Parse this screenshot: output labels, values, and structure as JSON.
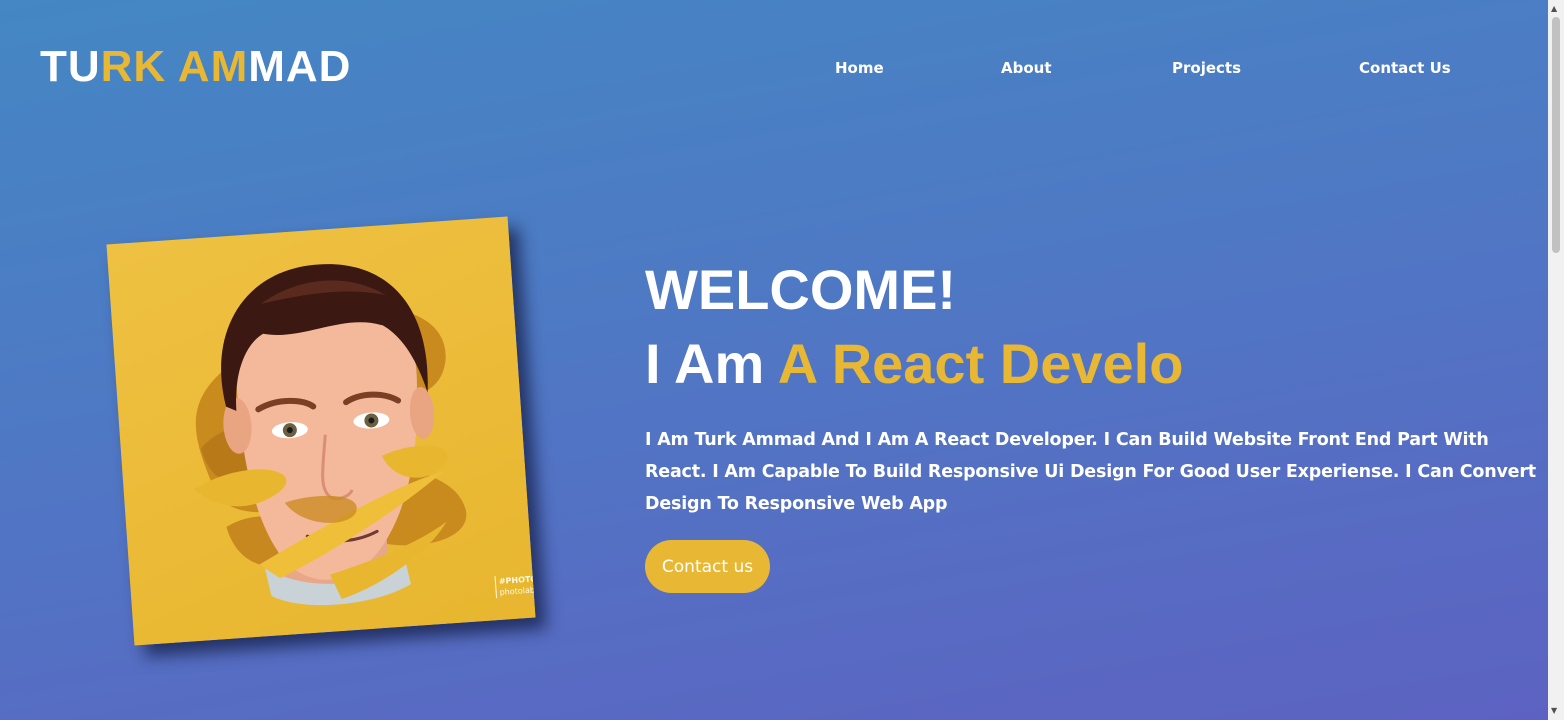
{
  "header": {
    "logo": {
      "part1": "TU",
      "part2": "RK AM",
      "part3": "MAD"
    },
    "nav": [
      {
        "label": "Home"
      },
      {
        "label": "About"
      },
      {
        "label": "Projects"
      },
      {
        "label": "Contact Us"
      }
    ]
  },
  "hero": {
    "title": "WELCOME!",
    "subtitle_prefix": "I Am ",
    "subtitle_highlight": "A React Develo",
    "description": "I Am Turk Ammad And I Am A React Developer. I Can Build Website Front End Part With React. I Am Capable To Build Responsive Ui Design For Good User Experiense. I Can Convert Design To Responsive Web App",
    "cta_label": "Contact us"
  },
  "photo": {
    "watermark_line1": "#PHOTOLAB",
    "watermark_line2": "photolab.me"
  },
  "scrollbar": {
    "up_arrow": "▲",
    "down_arrow": "▼"
  },
  "colors": {
    "accent": "#e8b834",
    "background_top": "#4487c4",
    "background_bottom": "#5d62c2",
    "text": "#ffffff"
  }
}
